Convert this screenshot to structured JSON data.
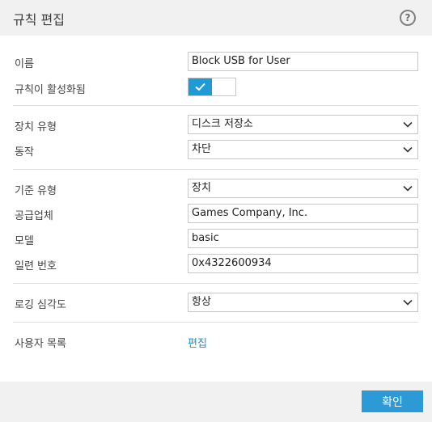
{
  "dialog": {
    "title": "규칙 편집",
    "help_glyph": "?"
  },
  "form": {
    "name": {
      "label": "이름",
      "value": "Block USB for User"
    },
    "enabled": {
      "label": "규칙이 활성화됨",
      "state": "on"
    },
    "device_type": {
      "label": "장치 유형",
      "value": "디스크 저장소"
    },
    "action": {
      "label": "동작",
      "value": "차단"
    },
    "criteria_type": {
      "label": "기준 유형",
      "value": "장치"
    },
    "vendor": {
      "label": "공급업체",
      "value": "Games Company, Inc."
    },
    "model": {
      "label": "모델",
      "value": "basic"
    },
    "serial": {
      "label": "일련 번호",
      "value": "0x4322600934"
    },
    "log_severity": {
      "label": "로깅 심각도",
      "value": "항상"
    },
    "user_list": {
      "label": "사용자 목록",
      "link": "편집"
    }
  },
  "footer": {
    "ok_label": "확인"
  },
  "colors": {
    "accent": "#1e9bd6",
    "link": "#1a8fd0",
    "button": "#2c9ad6"
  }
}
